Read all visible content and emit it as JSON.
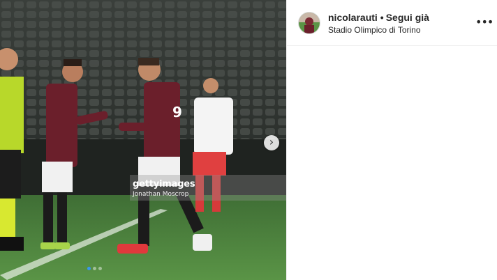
{
  "post": {
    "photo_alt": "Two football players exchange a captain's armband on the pitch",
    "watermark_logo": "gettyimages",
    "watermark_credit": "Jonathan Moscrop",
    "carousel": {
      "total": 3,
      "active_index": 0
    },
    "next_icon": "chevron-right-icon"
  },
  "header": {
    "username": "nicolarauti",
    "separator": "•",
    "follow_label": "Segui già",
    "location": "Stadio Olimpico di Torino",
    "more_icon": "ellipsis-icon",
    "more_label": "•••"
  },
  "colors": {
    "kit_maroon": "#6b1f2b",
    "pitch_green": "#4f8a3e",
    "active_dot": "#3897f0"
  }
}
